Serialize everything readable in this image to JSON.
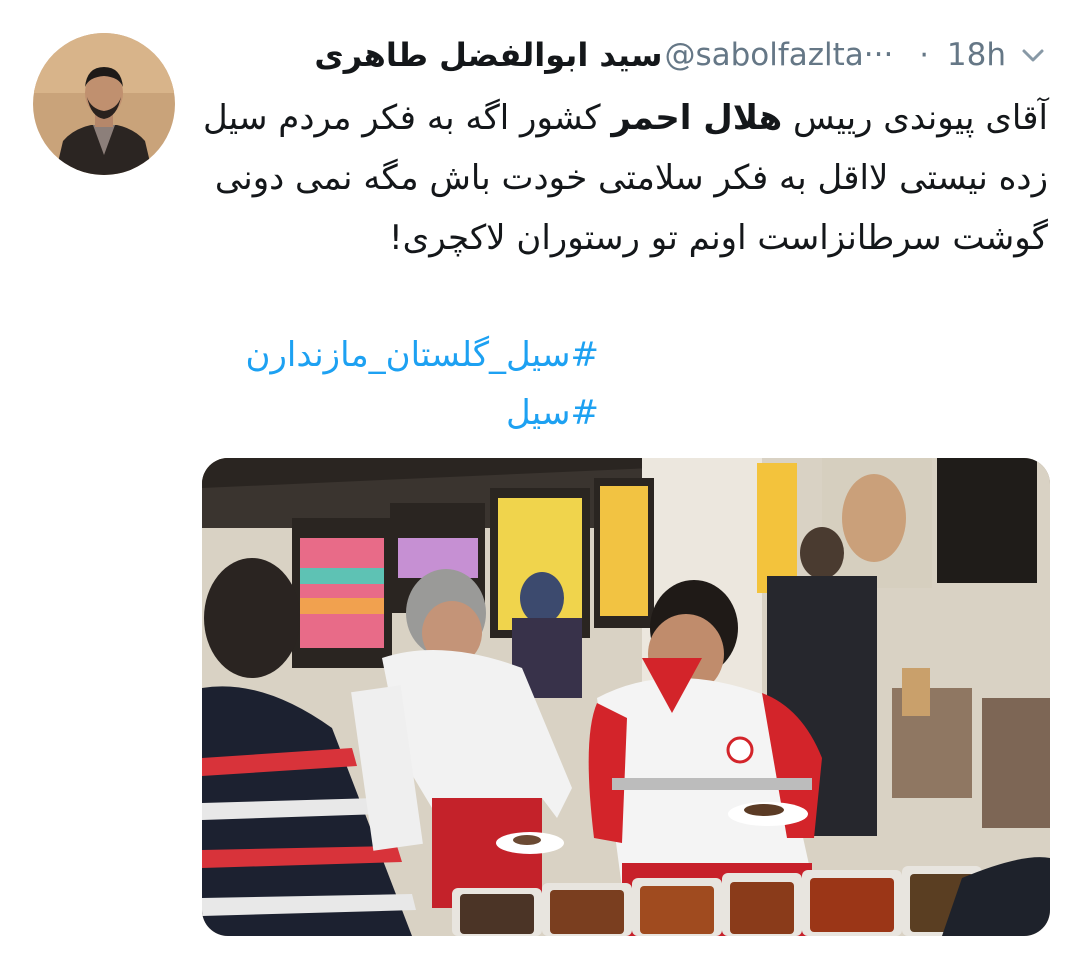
{
  "tweet": {
    "author_name": "سید ابوالفضل طاهری",
    "handle": "@sabolfazlta···",
    "separator": "·",
    "time": "18h",
    "text_parts": {
      "before_bold": "آقای پیوندی رییس ",
      "bold": "هلال احمر",
      "after_bold": " کشور اگه به فکر مردم سیل زده نیستی لااقل به فکر سلامتی خودت باش مگه نمی دونی گوشت سرطانزاست اونم تو رستوران لاکچری!"
    },
    "hashtags": [
      "#سیل_گلستان_مازندارن",
      "#سیل"
    ],
    "icons": {
      "avatar": "profile-avatar",
      "menu": "chevron-down-icon"
    },
    "colors": {
      "hashtag": "#1da1f2",
      "meta": "#657786",
      "text": "#14171a",
      "red_crescent": "#d3242a"
    }
  }
}
